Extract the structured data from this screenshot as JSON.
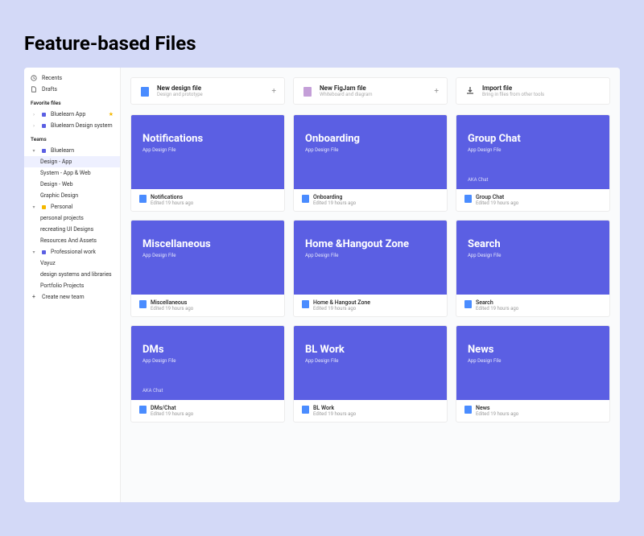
{
  "page_title": "Feature-based Files",
  "colors": {
    "accent": "#5b5fe3",
    "file_icon": "#4a8cff",
    "figjam": "#c49fd8",
    "star": "#f5b800"
  },
  "sidebar": {
    "top": [
      {
        "label": "Recents",
        "icon": "clock"
      },
      {
        "label": "Drafts",
        "icon": "file"
      }
    ],
    "fav_section": "Favorite files",
    "favorites": [
      {
        "label": "Bluelearn App",
        "starred": true,
        "color": "#5b5fe3"
      },
      {
        "label": "Bluelearn Design system",
        "starred": false,
        "color": "#5b5fe3"
      }
    ],
    "teams_section": "Teams",
    "teams": [
      {
        "label": "Bluelearn",
        "expanded": true,
        "color": "#5b5fe3",
        "items": [
          {
            "label": "Design - App",
            "active": true
          },
          {
            "label": "System - App & Web"
          },
          {
            "label": "Design - Web"
          },
          {
            "label": "Graphic Design"
          }
        ]
      },
      {
        "label": "Personal",
        "expanded": true,
        "color": "#f5b800",
        "items": [
          {
            "label": "personal projects"
          },
          {
            "label": "recreating UI Designs"
          },
          {
            "label": "Resources And Assets"
          }
        ]
      },
      {
        "label": "Professional work",
        "expanded": true,
        "color": "#5b5fe3",
        "items": [
          {
            "label": "Vayuz"
          },
          {
            "label": "design systems and libraries"
          },
          {
            "label": "Portfolio Projects"
          }
        ]
      }
    ],
    "create_team": "Create new team"
  },
  "actions": [
    {
      "title": "New design file",
      "subtitle": "Design and prototype",
      "icon": "design",
      "plus": true
    },
    {
      "title": "New FigJam file",
      "subtitle": "Whiteboard and diagram",
      "icon": "figjam",
      "plus": true
    },
    {
      "title": "Import file",
      "subtitle": "Bring in files from other tools",
      "icon": "import",
      "plus": false
    }
  ],
  "files": [
    {
      "thumb_title": "Notifications",
      "thumb_sub": "App Design File",
      "aka": "",
      "name": "Notifications",
      "edited": "Edited 19 hours ago"
    },
    {
      "thumb_title": "Onboarding",
      "thumb_sub": "App Design File",
      "aka": "",
      "name": "Onboarding",
      "edited": "Edited 19 hours ago"
    },
    {
      "thumb_title": "Group Chat",
      "thumb_sub": "App Design File",
      "aka": "AKA Chat",
      "name": "Group Chat",
      "edited": "Edited 19 hours ago"
    },
    {
      "thumb_title": "Miscellaneous",
      "thumb_sub": "App Design File",
      "aka": "",
      "name": "Miscellaneous",
      "edited": "Edited 19 hours ago"
    },
    {
      "thumb_title": "Home &Hangout Zone",
      "thumb_sub": "App Design File",
      "aka": "",
      "name": "Home & Hangout Zone",
      "edited": "Edited 19 hours ago"
    },
    {
      "thumb_title": "Search",
      "thumb_sub": "App Design File",
      "aka": "",
      "name": "Search",
      "edited": "Edited 19 hours ago"
    },
    {
      "thumb_title": "DMs",
      "thumb_sub": "App Design File",
      "aka": "AKA Chat",
      "name": "DMs/Chat",
      "edited": "Edited 19 hours ago"
    },
    {
      "thumb_title": "BL Work",
      "thumb_sub": "App Design File",
      "aka": "",
      "name": "BL Work",
      "edited": "Edited 19 hours ago"
    },
    {
      "thumb_title": "News",
      "thumb_sub": "App Design File",
      "aka": "",
      "name": "News",
      "edited": "Edited 19 hours ago"
    }
  ]
}
